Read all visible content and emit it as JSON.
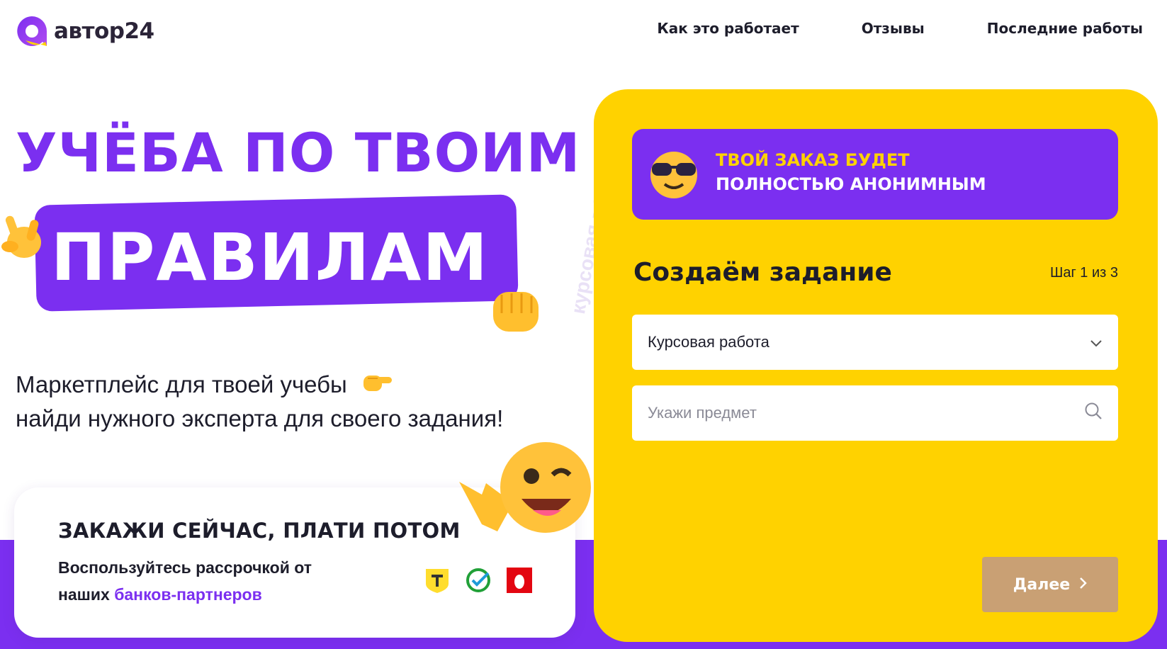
{
  "header": {
    "logo_text": "автор24",
    "nav": [
      {
        "label": "Как это работает"
      },
      {
        "label": "Отзывы"
      },
      {
        "label": "Последние работы"
      }
    ]
  },
  "hero": {
    "line1": "УЧЁБА ПО ТВОИМ",
    "line2": "ПРАВИЛАМ",
    "sub_line1": "Маркетплейс для твоей учебы",
    "sub_line2": "найди нужного эксперта для своего задания!",
    "watermark": "курсовая ▪ с"
  },
  "promo": {
    "title": "ЗАКАЖИ СЕЙЧАС, ПЛАТИ ПОТОМ",
    "text": "Воспользуйтесь рассрочкой от наших",
    "link": "банков-партнеров",
    "banks": [
      "t-bank-icon",
      "sber-icon",
      "mts-icon"
    ]
  },
  "form": {
    "banner_line1": "ТВОЙ ЗАКАЗ БУДЕТ",
    "banner_line2": "ПОЛНОСТЬЮ АНОНИМНЫМ",
    "title": "Создаём задание",
    "step": "Шаг 1 из 3",
    "work_type_value": "Курсовая работа",
    "subject_placeholder": "Укажи предмет",
    "next_label": "Далее"
  },
  "colors": {
    "accent": "#7b2ff0",
    "yellow": "#ffd200",
    "button_disabled": "#c9a074"
  }
}
